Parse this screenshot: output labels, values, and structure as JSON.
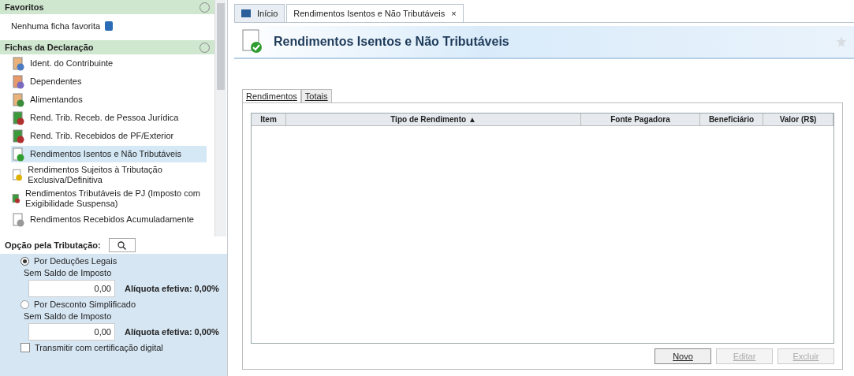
{
  "favorites": {
    "title": "Favoritos",
    "empty_text": "Nenhuma ficha favorita"
  },
  "fichas": {
    "title": "Fichas da Declaração",
    "items": [
      {
        "label": "Ident. do Contribuinte",
        "selected": false,
        "kind": "person"
      },
      {
        "label": "Dependentes",
        "selected": false,
        "kind": "people"
      },
      {
        "label": "Alimentandos",
        "selected": false,
        "kind": "family"
      },
      {
        "label": "Rend. Trib. Receb. de Pessoa Jurídica",
        "selected": false,
        "kind": "money"
      },
      {
        "label": "Rend. Trib. Recebidos de PF/Exterior",
        "selected": false,
        "kind": "money"
      },
      {
        "label": "Rendimentos Isentos e Não Tributáveis",
        "selected": true,
        "kind": "check"
      },
      {
        "label": "Rendimentos Sujeitos à Tributação Exclusiva/Definitiva",
        "selected": false,
        "kind": "warn"
      },
      {
        "label": "Rendimentos Tributáveis de PJ (Imposto com Exigibilidade Suspensa)",
        "selected": false,
        "kind": "money"
      },
      {
        "label": "Rendimentos Recebidos Acumuladamente",
        "selected": false,
        "kind": "doc"
      }
    ]
  },
  "opcao": {
    "title": "Opção pela Tributação:",
    "options": [
      {
        "label": "Por Deduções Legais",
        "selected": true,
        "status": "Sem Saldo de Imposto",
        "value": "0,00",
        "aliquota": "Alíquota efetiva: 0,00%"
      },
      {
        "label": "Por Desconto Simplificado",
        "selected": false,
        "status": "Sem Saldo de Imposto",
        "value": "0,00",
        "aliquota": "Alíquota efetiva: 0,00%"
      }
    ],
    "certificacao": {
      "label": "Transmitir com certificação digital",
      "checked": false
    }
  },
  "tabs": [
    {
      "label": "Início",
      "selected": false,
      "closable": false
    },
    {
      "label": "Rendimentos Isentos e Não Tributáveis",
      "selected": true,
      "closable": true
    }
  ],
  "close_glyph": "×",
  "header": {
    "title": "Rendimentos Isentos e Não Tributáveis"
  },
  "subtabs": [
    {
      "label": "Rendimentos",
      "selected": true
    },
    {
      "label": "Totais",
      "selected": false
    }
  ],
  "table": {
    "columns": [
      "Item",
      "Tipo de Rendimento",
      "Fonte Pagadora",
      "Beneficiário",
      "Valor (R$)"
    ],
    "sort_glyph": "▲"
  },
  "buttons": [
    {
      "label": "Novo",
      "disabled": false
    },
    {
      "label": "Editar",
      "disabled": true
    },
    {
      "label": "Excluir",
      "disabled": true
    }
  ]
}
